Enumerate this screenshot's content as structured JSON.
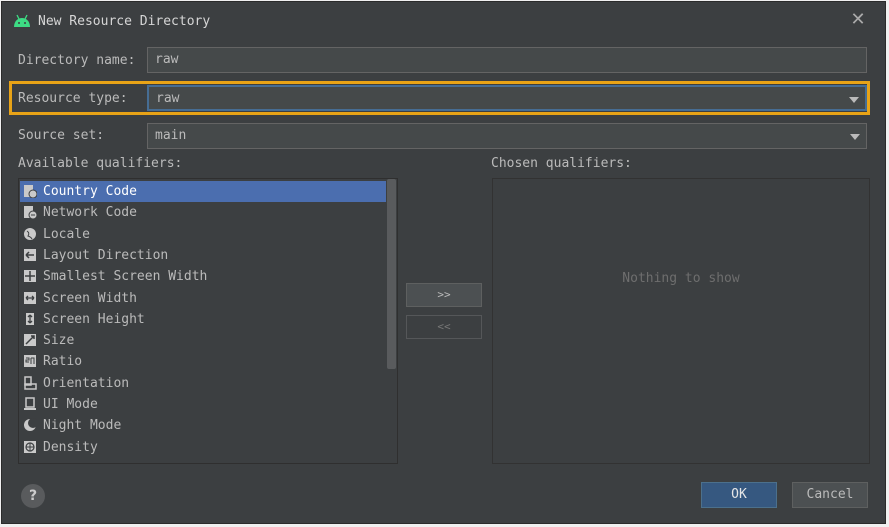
{
  "window": {
    "title": "New Resource Directory",
    "icon": "android-icon",
    "close_glyph": "✕"
  },
  "form": {
    "directory_name": {
      "label": "Directory name:",
      "value": "raw"
    },
    "resource_type": {
      "label": "Resource type:",
      "value": "raw"
    },
    "source_set": {
      "label": "Source set:",
      "value": "main"
    }
  },
  "available": {
    "label": "Available qualifiers:",
    "items": [
      {
        "label": "Country Code",
        "icon": "country-code-icon"
      },
      {
        "label": "Network Code",
        "icon": "network-code-icon"
      },
      {
        "label": "Locale",
        "icon": "globe-icon"
      },
      {
        "label": "Layout Direction",
        "icon": "layout-direction-icon"
      },
      {
        "label": "Smallest Screen Width",
        "icon": "smallest-width-icon"
      },
      {
        "label": "Screen Width",
        "icon": "screen-width-icon"
      },
      {
        "label": "Screen Height",
        "icon": "screen-height-icon"
      },
      {
        "label": "Size",
        "icon": "size-icon"
      },
      {
        "label": "Ratio",
        "icon": "ratio-icon"
      },
      {
        "label": "Orientation",
        "icon": "orientation-icon"
      },
      {
        "label": "UI Mode",
        "icon": "ui-mode-icon"
      },
      {
        "label": "Night Mode",
        "icon": "night-mode-icon"
      },
      {
        "label": "Density",
        "icon": "density-icon"
      }
    ],
    "selected_index": 0
  },
  "move_buttons": {
    "add": ">>",
    "remove": "<<"
  },
  "chosen": {
    "label": "Chosen qualifiers:",
    "empty_text": "Nothing to show"
  },
  "buttons": {
    "help": "?",
    "ok": "OK",
    "cancel": "Cancel"
  },
  "colors": {
    "dialog_bg": "#3c3f41",
    "selection": "#4b6eaf",
    "highlight": "#e8a317",
    "ok_button": "#365880"
  }
}
